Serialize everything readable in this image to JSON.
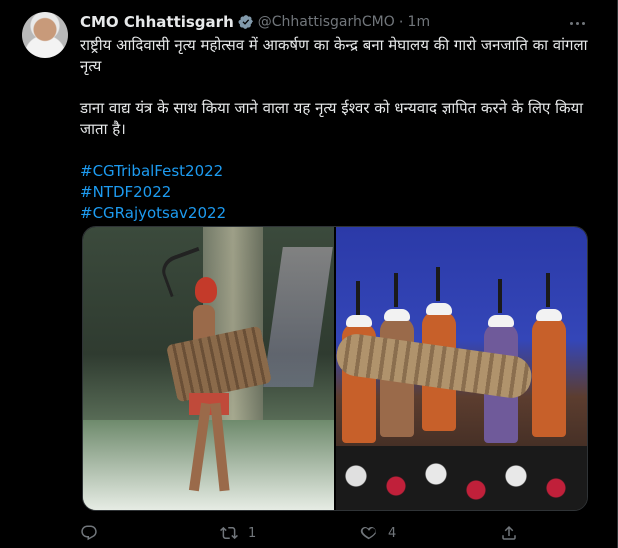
{
  "tweet": {
    "display_name": "CMO Chhattisgarh",
    "handle": "@ChhattisgarhCMO",
    "separator": "·",
    "time": "1m",
    "text_line1": "राष्ट्रीय आदिवासी नृत्य महोत्सव में आकर्षण का केन्द्र बना मेघालय की गारो जनजाति का वांगला नृत्य",
    "text_line2": "डाना वाद्य यंत्र के साथ किया जाने वाला यह नृत्य ईश्वर को धन्यवाद ज्ञापित करने के लिए किया जाता है।",
    "hashtags": [
      "#CGTribalFest2022",
      "#NTDF2022",
      "#CGRajyotsav2022"
    ]
  },
  "actions": {
    "reply_count": "",
    "retweet_count": "1",
    "like_count": "4",
    "share_count": ""
  },
  "icons": {
    "verified": "verified-badge-icon",
    "more": "more-options-icon",
    "reply": "reply-icon",
    "retweet": "retweet-icon",
    "like": "heart-icon",
    "share": "share-icon"
  },
  "colors": {
    "background": "#000000",
    "text": "#e7e9ea",
    "muted": "#71767b",
    "link": "#1d9bf0"
  }
}
